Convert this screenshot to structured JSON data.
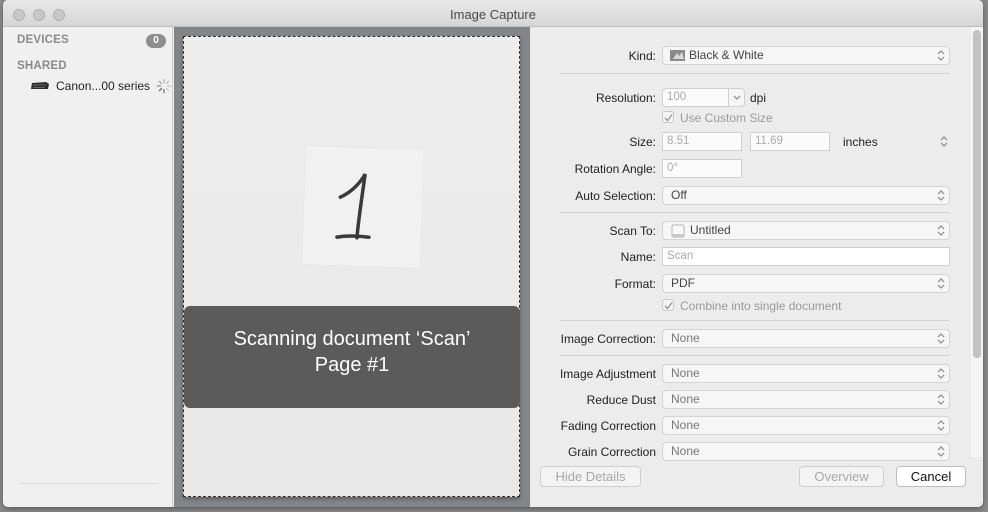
{
  "window": {
    "title": "Image Capture"
  },
  "sidebar": {
    "devices_header": "DEVICES",
    "devices_count": "0",
    "shared_header": "SHARED",
    "shared_items": [
      {
        "label": "Canon...00 series",
        "icon": "printer-icon",
        "status": "loading-spinner"
      }
    ]
  },
  "preview": {
    "handwritten_digit": "1",
    "overlay_line1": "Scanning document ‘Scan’",
    "overlay_line2": "Page #1"
  },
  "details": {
    "kind": {
      "label": "Kind:",
      "value": "Black & White",
      "icon": "photo-icon"
    },
    "resolution": {
      "label": "Resolution:",
      "value": "100",
      "unit": "dpi"
    },
    "use_custom_size": {
      "label": "Use Custom Size",
      "checked": true
    },
    "size": {
      "label": "Size:",
      "width": "8.51",
      "height": "11.69",
      "unit": "inches"
    },
    "rotation": {
      "label": "Rotation Angle:",
      "value": "0°"
    },
    "auto_selection": {
      "label": "Auto Selection:",
      "value": "Off"
    },
    "scan_to": {
      "label": "Scan To:",
      "value": "Untitled",
      "icon": "drive-icon"
    },
    "name": {
      "label": "Name:",
      "placeholder": "Scan"
    },
    "format": {
      "label": "Format:",
      "value": "PDF"
    },
    "combine": {
      "label": "Combine into single document",
      "checked": true
    },
    "image_correction": {
      "label": "Image Correction:",
      "value": "None"
    },
    "image_adjustment": {
      "label": "Image Adjustment",
      "value": "None"
    },
    "reduce_dust": {
      "label": "Reduce Dust",
      "value": "None"
    },
    "fading_correction": {
      "label": "Fading Correction",
      "value": "None"
    },
    "grain_correction": {
      "label": "Grain Correction",
      "value": "None"
    }
  },
  "buttons": {
    "hide_details": "Hide Details",
    "overview": "Overview",
    "cancel": "Cancel"
  }
}
